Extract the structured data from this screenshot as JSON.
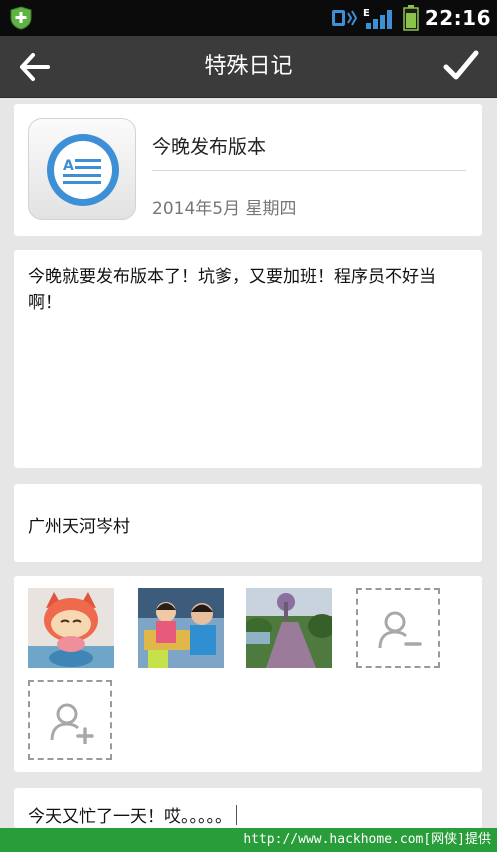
{
  "status_bar": {
    "time": "22:16",
    "network": "E",
    "icons": [
      "shield-icon",
      "vibrate-icon",
      "signal-icon",
      "battery-icon"
    ]
  },
  "title_bar": {
    "title": "特殊日记",
    "back_icon": "arrow-left-icon",
    "confirm_icon": "checkmark-icon"
  },
  "diary": {
    "title": "今晚发布版本",
    "date": "2014年5月  星期四",
    "content": "今晚就要发布版本了！坑爹，又要加班！程序员不好当啊！",
    "location": "广州天河岑村",
    "photos": [
      {
        "icon": "photo-cat-doll-icon"
      },
      {
        "icon": "photo-kids-icon"
      },
      {
        "icon": "photo-park-icon"
      }
    ],
    "actions": {
      "remove_icon": "remove-person-icon",
      "add_icon": "add-person-icon"
    },
    "next_entry": "今天又忙了一天！哎。。。。。"
  },
  "watermark": "http://www.hackhome.com[网侠]提供",
  "colors": {
    "title_bar": "#3b3b3b",
    "status_bar": "#0b0b0b",
    "accent_blue": "#3d8fd6",
    "watermark_green": "#2a9d3b"
  }
}
